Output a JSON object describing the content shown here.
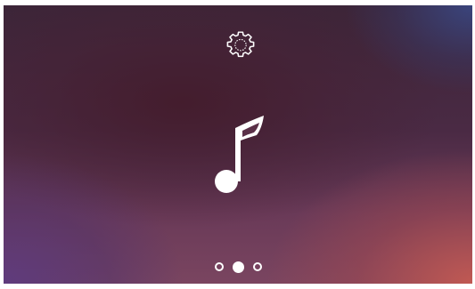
{
  "screen": {
    "settings_icon": "gear-icon",
    "center_icon": "music-note-icon",
    "icon_color": "#ffffff"
  },
  "pager": {
    "page_count": 3,
    "active_page": 2
  }
}
